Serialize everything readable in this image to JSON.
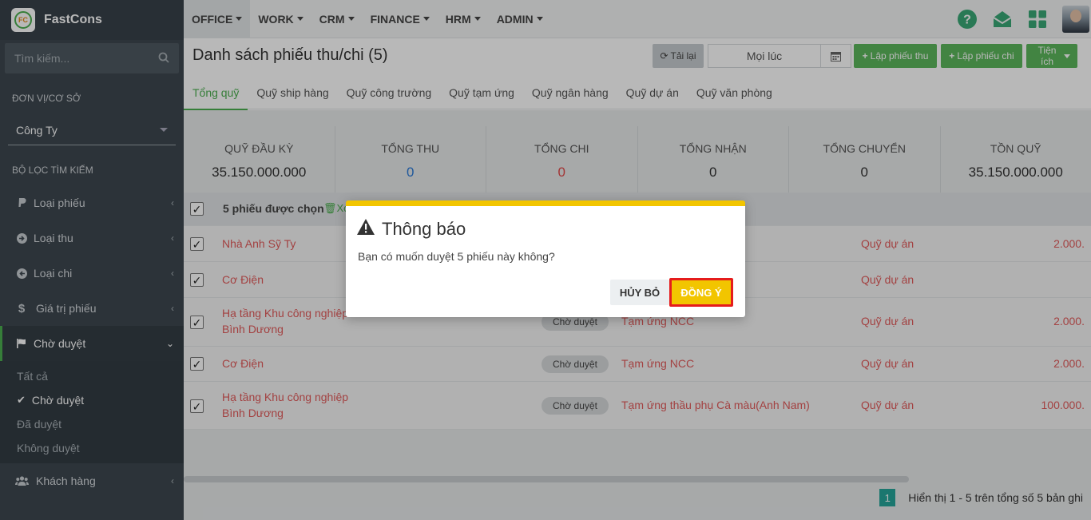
{
  "brand": {
    "logo_text": "FC",
    "name": "FastCons"
  },
  "sidebar": {
    "search_placeholder": "Tìm kiếm...",
    "unit_label": "ĐƠN VỊ/CƠ SỞ",
    "unit_value": "Công Ty",
    "filter_label": "BỘ LỌC TÌM KIẾM",
    "items": [
      {
        "label": "Loại phiếu",
        "icon": "paypal-icon"
      },
      {
        "label": "Loại thu",
        "icon": "arrow-circle-right-icon"
      },
      {
        "label": "Loại chi",
        "icon": "arrow-circle-left-icon"
      },
      {
        "label": "Giá trị phiếu",
        "icon": "dollar-icon"
      },
      {
        "label": "Chờ duyệt",
        "icon": "flag-icon"
      },
      {
        "label": "Khách hàng",
        "icon": "users-icon"
      }
    ],
    "sub_items": [
      {
        "label": "Tất cả"
      },
      {
        "label": "Chờ duyệt"
      },
      {
        "label": "Đã duyệt"
      },
      {
        "label": "Không duyệt"
      }
    ]
  },
  "topnav": {
    "items": [
      "OFFICE",
      "WORK",
      "CRM",
      "FINANCE",
      "HRM",
      "ADMIN"
    ]
  },
  "header": {
    "title": "Danh sách phiếu thu/chi (5)",
    "reload_label": "Tải lại",
    "date_range_value": "Mọi lúc",
    "create_receipt_label": "Lập phiếu thu",
    "create_payment_label": "Lập phiếu chi",
    "utilities_label": "Tiện ích"
  },
  "tabs": [
    "Tổng quỹ",
    "Quỹ ship hàng",
    "Quỹ công trường",
    "Quỹ tạm ứng",
    "Quỹ ngân hàng",
    "Quỹ dự án",
    "Quỹ văn phòng"
  ],
  "summary": [
    {
      "label": "QUỸ ĐẦU KỲ",
      "value": "35.150.000.000"
    },
    {
      "label": "TỔNG THU",
      "value": "0"
    },
    {
      "label": "TỔNG CHI",
      "value": "0"
    },
    {
      "label": "TỔNG NHẬN",
      "value": "0"
    },
    {
      "label": "TỔNG CHUYỂN",
      "value": "0"
    },
    {
      "label": "TỒN QUỸ",
      "value": "35.150.000.000"
    }
  ],
  "table": {
    "selected_text": "5 phiếu được chọn",
    "delete_text": "Xó",
    "rows": [
      {
        "name_line1": "Nhà Anh Sỹ Ty",
        "name_line2": "",
        "status": "",
        "type": "",
        "fund": "Quỹ dự án",
        "amount": "2.000."
      },
      {
        "name_line1": "Cơ Điện",
        "name_line2": "",
        "status": "",
        "type": "",
        "fund": "Quỹ dự án",
        "amount": ""
      },
      {
        "name_line1": "Hạ tầng Khu công nghiệp",
        "name_line2": "Bình Dương",
        "status": "Chờ duyệt",
        "type": "Tạm ứng NCC",
        "fund": "Quỹ dự án",
        "amount": "2.000."
      },
      {
        "name_line1": "Cơ Điện",
        "name_line2": "",
        "status": "Chờ duyệt",
        "type": "Tạm ứng NCC",
        "fund": "Quỹ dự án",
        "amount": "2.000."
      },
      {
        "name_line1": "Hạ tầng Khu công nghiệp",
        "name_line2": "Bình Dương",
        "status": "Chờ duyệt",
        "type": "Tạm ứng thầu phụ Cà màu(Anh Nam)",
        "fund": "Quỹ dự án",
        "amount": "100.000."
      }
    ]
  },
  "footer": {
    "page": "1",
    "info": "Hiển thị 1 - 5 trên tổng số 5 bản ghi"
  },
  "modal": {
    "title": "Thông báo",
    "message": "Bạn có muốn duyệt 5 phiếu này không?",
    "cancel_label": "HỦY BỎ",
    "ok_label": "ĐỒNG Ý"
  },
  "colors": {
    "sidebar_bg": "#3d474f",
    "accent_green": "#4caf50",
    "alert_yellow": "#f2c500",
    "danger_red": "#e25a5a",
    "highlight_red": "#e51c1c"
  }
}
